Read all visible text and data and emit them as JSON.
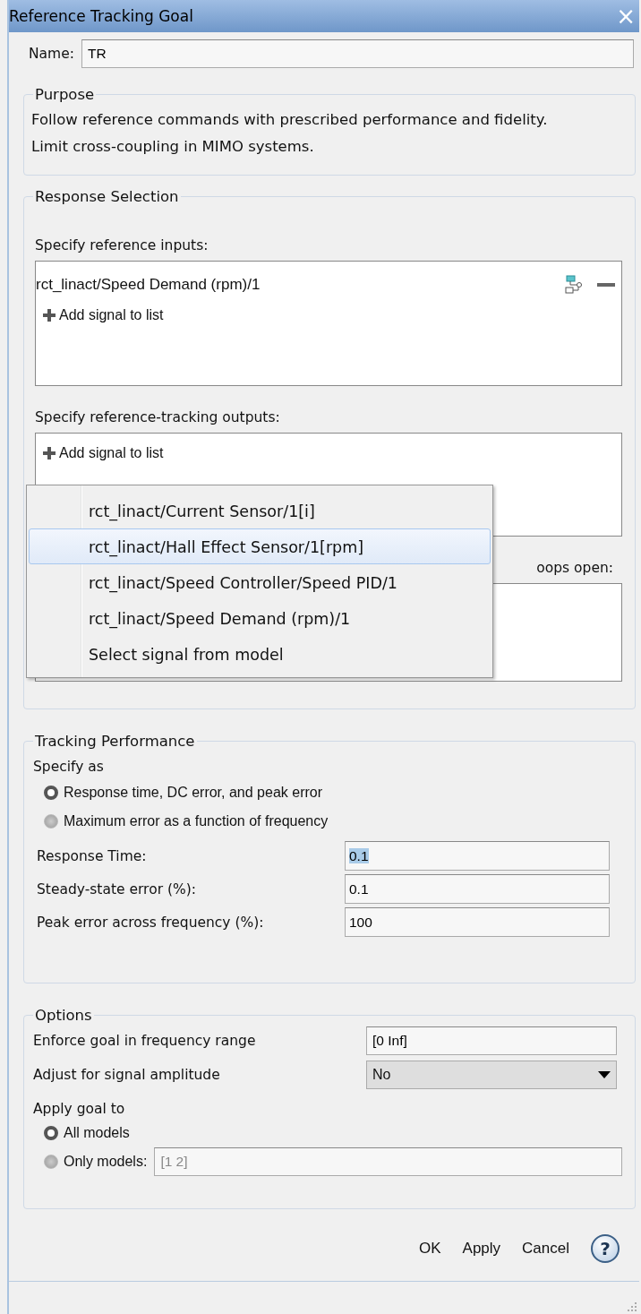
{
  "window": {
    "title": "Reference Tracking Goal",
    "close": "×"
  },
  "name": {
    "label": "Name:",
    "value": "TR"
  },
  "purpose": {
    "title": "Purpose",
    "text": "Follow reference commands with prescribed performance and fidelity. Limit cross-coupling in MIMO systems."
  },
  "response_selection": {
    "title": "Response Selection",
    "inputs": {
      "label": "Specify reference inputs:",
      "signals": [
        "rct_linact/Speed Demand (rpm)/1"
      ],
      "add": "Add signal to list"
    },
    "outputs": {
      "label": "Specify reference-tracking outputs:",
      "add": "Add signal to list"
    },
    "loops": {
      "label": "oops open:"
    },
    "menu": {
      "items": [
        {
          "label": "rct_linact/Current Sensor/1[i]",
          "selected": false
        },
        {
          "label": "rct_linact/Hall Effect Sensor/1[rpm]",
          "selected": true
        },
        {
          "label": "rct_linact/Speed Controller/Speed PID/1",
          "selected": false
        },
        {
          "label": "rct_linact/Speed Demand (rpm)/1",
          "selected": false
        },
        {
          "label": "Select signal from model",
          "selected": false
        }
      ]
    }
  },
  "tracking_performance": {
    "title": "Tracking Performance",
    "specify_label": "Specify as",
    "options": [
      {
        "label": "Response time, DC error, and peak error",
        "selected": true
      },
      {
        "label": "Maximum error as a function of frequency",
        "selected": false
      }
    ],
    "fields": [
      {
        "label": "Response Time:",
        "value": "0.1",
        "text_selected": true
      },
      {
        "label": "Steady-state error (%):",
        "value": "0.1",
        "text_selected": false
      },
      {
        "label": "Peak error across frequency (%):",
        "value": "100",
        "text_selected": false
      }
    ]
  },
  "options": {
    "title": "Options",
    "fields": [
      {
        "kind": "text",
        "label": "Enforce goal in frequency range",
        "value": "[0 Inf]"
      },
      {
        "kind": "dropdown",
        "label": "Adjust for signal amplitude",
        "value": "No"
      }
    ],
    "apply_label": "Apply goal to",
    "choices": [
      {
        "label": "All models",
        "selected": true
      },
      {
        "label": "Only models:",
        "selected": false,
        "value": "[1 2]"
      }
    ]
  },
  "buttons": [
    "OK",
    "Apply",
    "Cancel"
  ],
  "help": "?"
}
